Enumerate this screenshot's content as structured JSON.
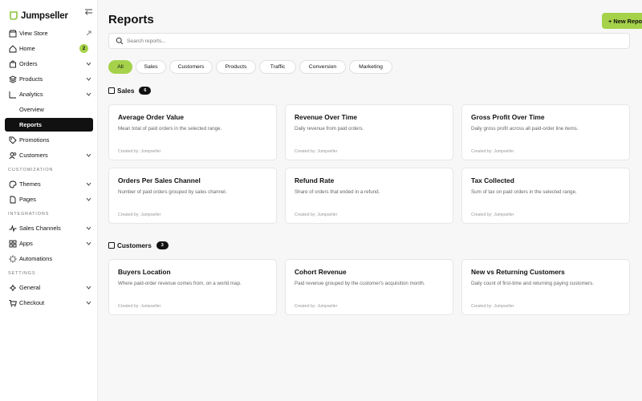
{
  "brand": {
    "name": "Jumpseller"
  },
  "sidebar": {
    "items": [
      {
        "label": "View Store"
      },
      {
        "label": "Home",
        "badge": "2"
      },
      {
        "label": "Orders"
      },
      {
        "label": "Products"
      },
      {
        "label": "Analytics"
      },
      {
        "label": "Overview"
      },
      {
        "label": "Reports"
      },
      {
        "label": "Promotions"
      },
      {
        "label": "Customers"
      },
      {
        "label": "Themes"
      },
      {
        "label": "Pages"
      },
      {
        "label": "Sales Channels"
      },
      {
        "label": "Apps"
      },
      {
        "label": "Automations"
      },
      {
        "label": "General"
      },
      {
        "label": "Checkout"
      }
    ],
    "sections": [
      "CUSTOMIZATION",
      "INTEGRATIONS",
      "SETTINGS"
    ]
  },
  "header": {
    "title": "Reports",
    "new_report_label": "+ New Report"
  },
  "search": {
    "placeholder": "Search reports..."
  },
  "filters": [
    "All",
    "Sales",
    "Customers",
    "Products",
    "Traffic",
    "Conversion",
    "Marketing"
  ],
  "active_filter": "All",
  "sections": [
    {
      "title": "Sales",
      "count": "6",
      "cards": [
        {
          "title": "Average Order Value",
          "desc": "Mean total of paid orders in the selected range.",
          "meta": "Created by: Jumpseller"
        },
        {
          "title": "Revenue Over Time",
          "desc": "Daily revenue from paid orders.",
          "meta": "Created by: Jumpseller"
        },
        {
          "title": "Gross Profit Over Time",
          "desc": "Daily gross profit across all paid-order line items.",
          "meta": "Created by: Jumpseller"
        },
        {
          "title": "Orders Per Sales Channel",
          "desc": "Number of paid orders grouped by sales channel.",
          "meta": "Created by: Jumpseller"
        },
        {
          "title": "Refund Rate",
          "desc": "Share of orders that ended in a refund.",
          "meta": "Created by: Jumpseller"
        },
        {
          "title": "Tax Collected",
          "desc": "Sum of tax on paid orders in the selected range.",
          "meta": "Created by: Jumpseller"
        }
      ]
    },
    {
      "title": "Customers",
      "count": "3",
      "cards": [
        {
          "title": "Buyers Location",
          "desc": "Where paid-order revenue comes from, on a world map.",
          "meta": "Created by: Jumpseller"
        },
        {
          "title": "Cohort Revenue",
          "desc": "Paid revenue grouped by the customer's acquisition month.",
          "meta": "Created by: Jumpseller"
        },
        {
          "title": "New vs Returning Customers",
          "desc": "Daily count of first-time and returning paying customers.",
          "meta": "Created by: Jumpseller"
        }
      ]
    }
  ],
  "colors": {
    "accent": "#a5d24a",
    "active_nav": "#111111"
  }
}
